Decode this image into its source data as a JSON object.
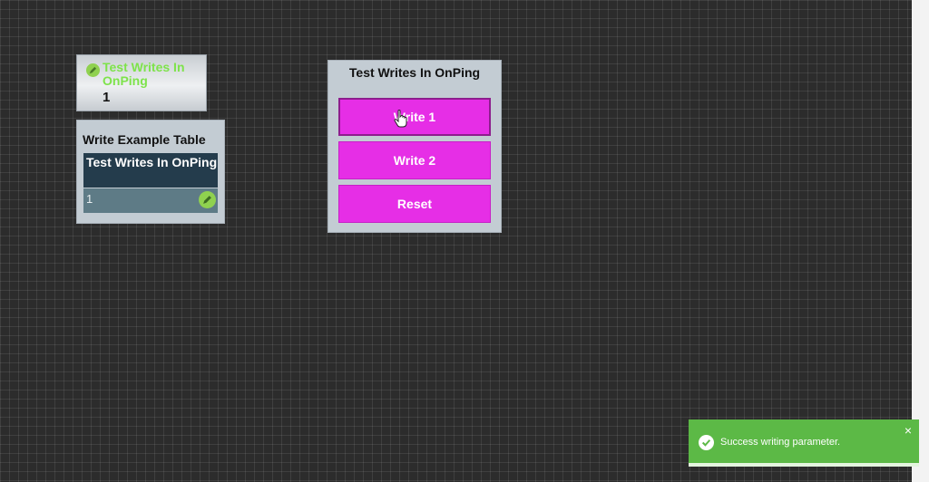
{
  "value_widget": {
    "title": "Test Writes In OnPing",
    "value": "1"
  },
  "table_widget": {
    "title": "Write Example Table",
    "column_header": "Test Writes In OnPing",
    "rows": [
      {
        "value": "1"
      }
    ]
  },
  "button_widget": {
    "title": "Test Writes In OnPing",
    "buttons": [
      {
        "label": "Write 1"
      },
      {
        "label": "Write 2"
      },
      {
        "label": "Reset"
      }
    ]
  },
  "toast": {
    "message": "Success writing parameter.",
    "close_symbol": "×"
  },
  "colors": {
    "button_magenta": "#e62ee6",
    "success_green": "#5cb946",
    "edit_icon_green": "#8fd14f",
    "table_header": "#243c4c"
  },
  "icons": [
    "edit-pencil-icon",
    "hand-cursor-icon",
    "check-circle-icon",
    "close-icon"
  ]
}
